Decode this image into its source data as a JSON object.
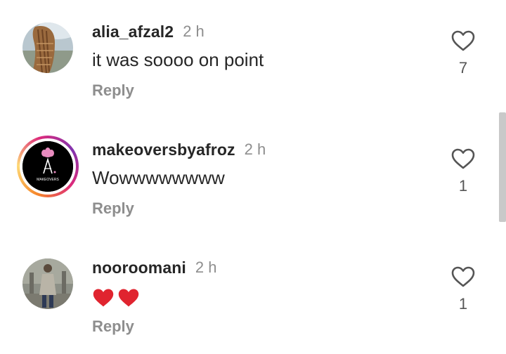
{
  "comments": [
    {
      "username": "alia_afzal2",
      "time": "2 h",
      "text": "it was soooo on point",
      "reply_label": "Reply",
      "likes": "7",
      "avatar_icon": "avatar-photo-braided-hair",
      "has_story_ring": false
    },
    {
      "username": "makeoversbyafroz",
      "time": "2 h",
      "text": "Wowwwwwwww",
      "reply_label": "Reply",
      "likes": "1",
      "avatar_icon": "avatar-logo-makeovers",
      "has_story_ring": true,
      "avatar_logo_text": "MAKEOVERS"
    },
    {
      "username": "nooroomani",
      "time": "2 h",
      "text": "",
      "emoji": "red-heart-emoji x2",
      "reply_label": "Reply",
      "likes": "1",
      "avatar_icon": "avatar-photo-person",
      "has_story_ring": false
    }
  ],
  "colors": {
    "text": "#262626",
    "muted": "#8e8e8e",
    "heart_emoji": "#e0242f",
    "story_ring": [
      "#f58529",
      "#dd2a7b",
      "#8134af"
    ]
  },
  "icons": {
    "like": "heart-outline-icon"
  }
}
